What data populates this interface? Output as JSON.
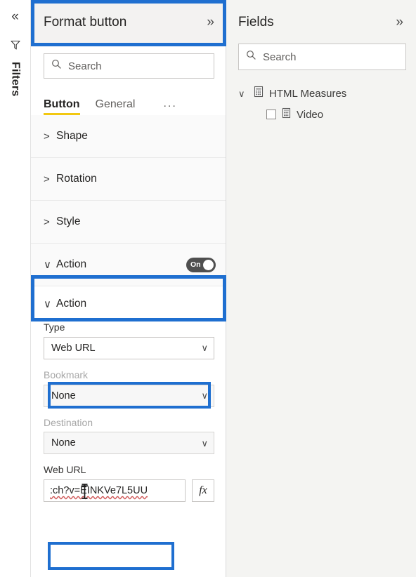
{
  "left_rail": {
    "collapse_icon": "chevron-double-left",
    "filter_icon": "funnel",
    "label": "Filters"
  },
  "format_pane": {
    "title": "Format button",
    "expand_icon": "chevron-double-right",
    "search": {
      "placeholder": "Search",
      "icon": "search-icon"
    },
    "tabs": [
      {
        "label": "Button",
        "active": true
      },
      {
        "label": "General",
        "active": false
      }
    ],
    "tab_overflow_label": "...",
    "sections": [
      {
        "label": "Shape",
        "expanded": false
      },
      {
        "label": "Rotation",
        "expanded": false
      },
      {
        "label": "Style",
        "expanded": false
      },
      {
        "label": "Action",
        "expanded": true,
        "toggle_state": "On"
      }
    ],
    "action": {
      "sub_header": "Action",
      "type_label": "Type",
      "type_value": "Web URL",
      "bookmark_label": "Bookmark",
      "bookmark_value": "None",
      "destination_label": "Destination",
      "destination_value": "None",
      "web_url_label": "Web URL",
      "web_url_value": ":ch?v=EINKVe7L5UU",
      "fx_label": "fx"
    }
  },
  "fields_pane": {
    "title": "Fields",
    "expand_icon": "chevron-double-right",
    "search": {
      "placeholder": "Search",
      "icon": "search-icon"
    },
    "tree": [
      {
        "label": "HTML Measures",
        "icon": "table-icon",
        "expanded": true,
        "children": [
          {
            "label": "Video",
            "icon": "measure-icon",
            "checked": false
          }
        ]
      }
    ]
  },
  "colors": {
    "highlight_blue": "#1f6fd0",
    "tab_accent": "#f2c811",
    "toggle_on": "#4f4f4f",
    "pane_bg": "#ffffff",
    "canvas_bg": "#f4f4f2"
  }
}
